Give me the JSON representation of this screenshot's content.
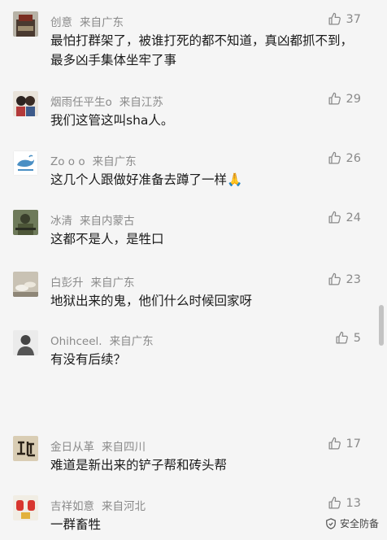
{
  "comments": [
    {
      "user": "创意",
      "location": "来自广东",
      "likes": "37",
      "text": "最怕打群架了，被谁打死的都不知道，真凶都抓不到，最多凶手集体坐牢了事",
      "avatar": "avatar-building-icon"
    },
    {
      "user": "烟雨任平生o",
      "location": "来自江苏",
      "likes": "29",
      "text": "我们这管这叫sha人。",
      "avatar": "avatar-couple-icon"
    },
    {
      "user": "Zo o o",
      "location": "来自广东",
      "likes": "26",
      "text": "这几个人跟做好准备去蹲了一样",
      "emoji": "🙏",
      "avatar": "avatar-whale-icon"
    },
    {
      "user": "冰清",
      "location": "来自内蒙古",
      "likes": "24",
      "text": "这都不是人，是牲口",
      "avatar": "avatar-soldier-icon"
    },
    {
      "user": "白彭升",
      "location": "来自广东",
      "likes": "23",
      "text": "地狱出来的鬼，他们什么时候回家呀",
      "avatar": "avatar-shoes-icon"
    },
    {
      "user": "Ohihceel.",
      "location": "来自广东",
      "likes": "5",
      "text": "有没有后续？",
      "avatar": "avatar-person-icon"
    },
    {
      "user": "金日从革",
      "location": "来自四川",
      "likes": "17",
      "text": "难道是新出来的铲子帮和砖头帮",
      "avatar": "avatar-calligraphy-icon"
    },
    {
      "user": "吉祥如意",
      "location": "来自河北",
      "likes": "13",
      "text": "一群畜牲",
      "avatar": "avatar-lantern-icon"
    }
  ],
  "watermark": {
    "label": "安全防备"
  },
  "colors": {
    "background": "#f5f5f5",
    "meta_text": "#8a8a8a",
    "body_text": "#1a1a1a",
    "like_icon": "#8a8a8a"
  }
}
